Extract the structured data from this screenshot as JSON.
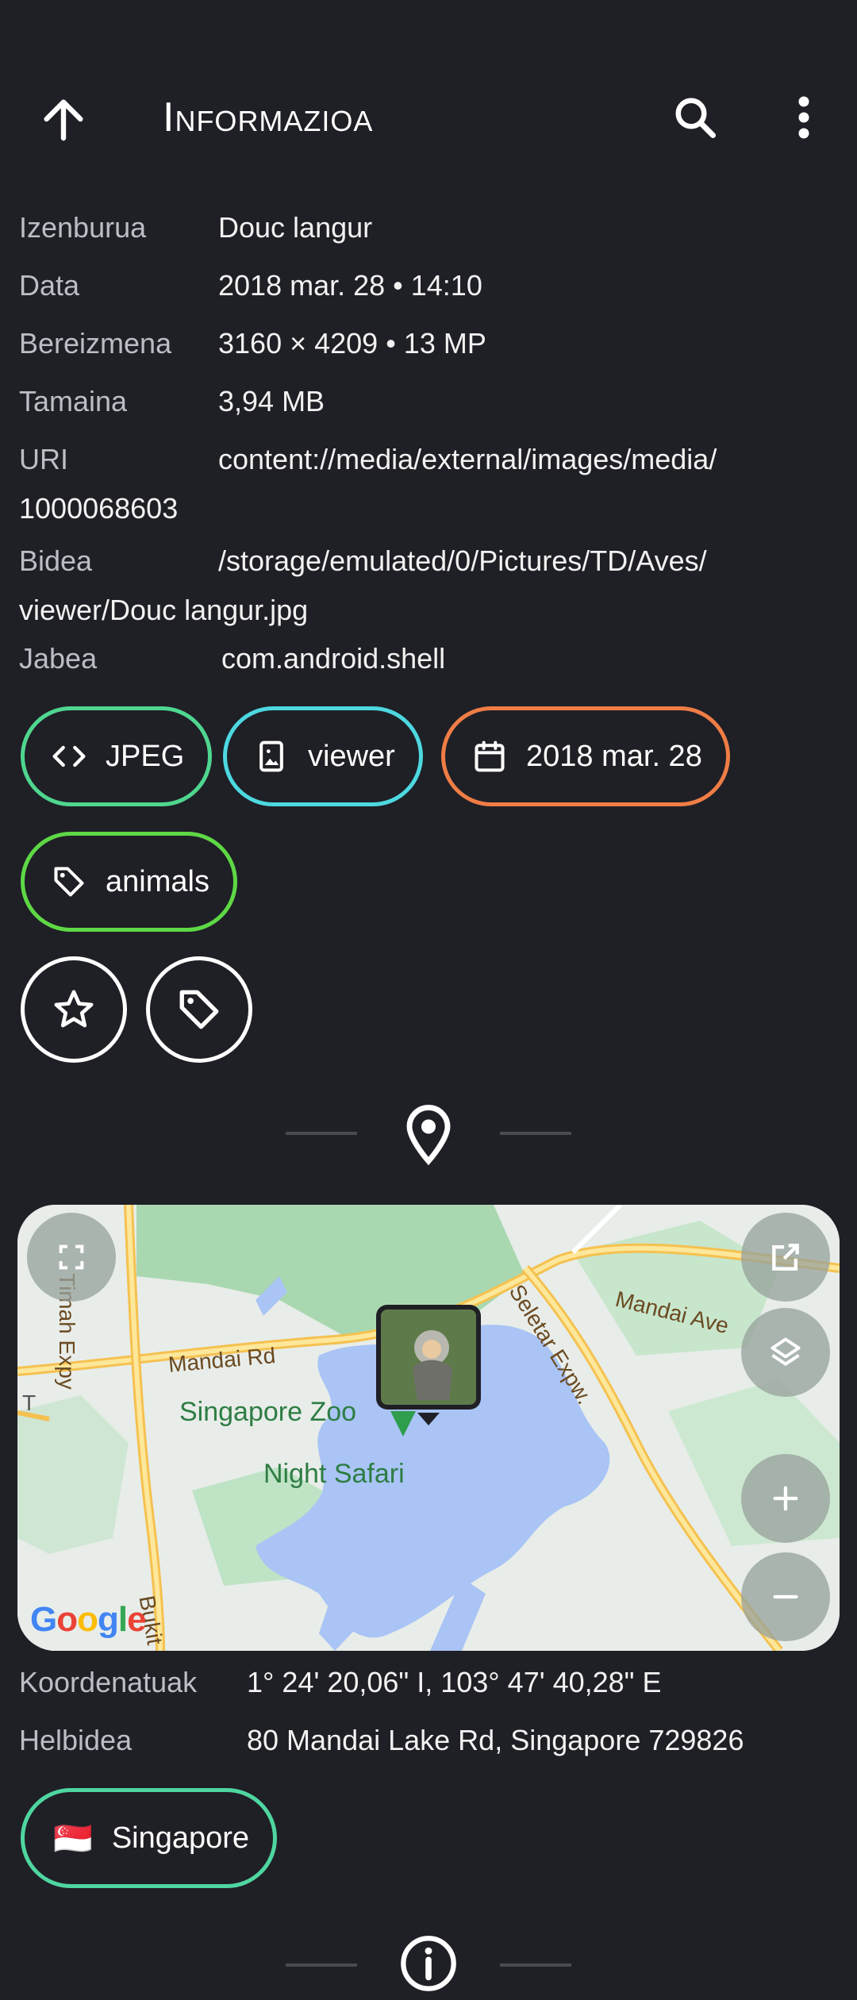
{
  "appbar": {
    "title": "Informazioa"
  },
  "info": {
    "rows": [
      {
        "label": "Izenburua",
        "value": "Douc langur"
      },
      {
        "label": "Data",
        "value": "2018 mar. 28 • 14:10"
      },
      {
        "label": "Bereizmena",
        "value": "3160 × 4209 • 13 MP"
      },
      {
        "label": "Tamaina",
        "value": "3,94 MB"
      },
      {
        "label": "URI",
        "value": "content://media/external/images/media/",
        "value_cont": "1000068603"
      },
      {
        "label": "Bidea",
        "value": "/storage/emulated/0/Pictures/TD/Aves/",
        "value_cont": "viewer/Douc langur.jpg"
      },
      {
        "label": "Jabea",
        "value": "com.android.shell"
      }
    ]
  },
  "chips": {
    "format": "JPEG",
    "album": "viewer",
    "date": "2018 mar. 28",
    "tag": "animals",
    "format_color": "#4fd68f",
    "album_color": "#4dd8e0",
    "date_color": "#ef7d45",
    "tag_color": "#5ed845"
  },
  "map": {
    "labels": {
      "zoo": "Singapore Zoo",
      "safari": "Night Safari",
      "mandai_rd": "Mandai Rd",
      "mandai_ave": "Mandai Ave",
      "seletar": "Seletar Expw.",
      "timah": "Timah Expy",
      "bukit": "Bukit",
      "edge_t": "T",
      "google": "Google"
    }
  },
  "location": {
    "coords_label": "Koordenatuak",
    "coords_value": "1° 24' 20,06\" I, 103° 47' 40,28\" E",
    "address_label": "Helbidea",
    "address_value": "80 Mandai Lake Rd, Singapore 729826",
    "country": "Singapore",
    "country_flag": "🇸🇬",
    "country_color": "#4fd6a0"
  }
}
